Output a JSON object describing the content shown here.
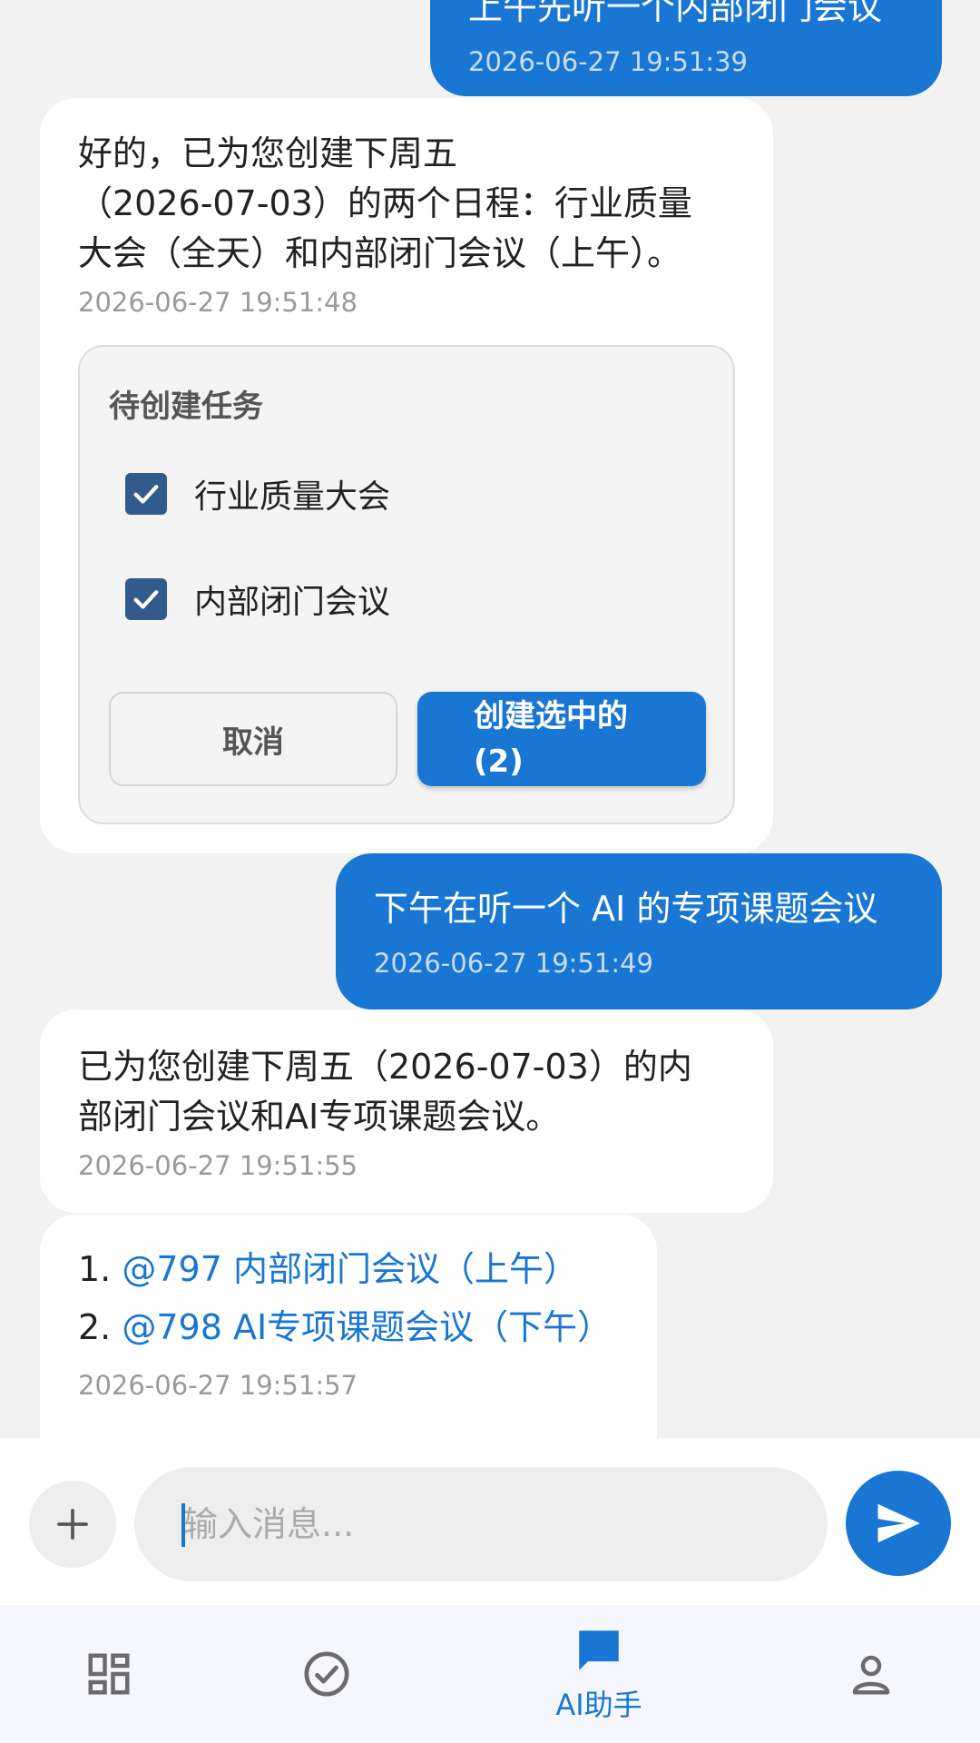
{
  "messages": [
    {
      "role": "user",
      "text": "上午先听一个内部闭门会议",
      "timestamp": "2026-06-27 19:51:39"
    },
    {
      "role": "assistant",
      "text_lines": [
        "好的，已为您创建下周五",
        "（2026-07-03）的两个日程：行业质量",
        "大会（全天）和内部闭门会议（上午）。"
      ],
      "timestamp": "2026-06-27 19:51:48"
    },
    {
      "role": "user",
      "text": "下午在听一个 AI 的专项课题会议",
      "timestamp": "2026-06-27 19:51:49"
    },
    {
      "role": "assistant",
      "text_lines": [
        "已为您创建下周五（2026-07-03）的内",
        "部闭门会议和AI专项课题会议。"
      ],
      "timestamp": "2026-06-27 19:51:55"
    },
    {
      "role": "assistant",
      "links": [
        {
          "prefix": "1. ",
          "text": "@797 内部闭门会议（上午）"
        },
        {
          "prefix": "2. ",
          "text": "@798 AI专项课题会议（下午）"
        }
      ],
      "timestamp": "2026-06-27 19:51:57"
    }
  ],
  "task_card": {
    "title": "待创建任务",
    "items": [
      {
        "label": "行业质量大会",
        "checked": true
      },
      {
        "label": "内部闭门会议",
        "checked": true
      }
    ],
    "cancel_label": "取消",
    "create_label_line1": "创建选中的",
    "create_label_line2": "(2)"
  },
  "input": {
    "placeholder": "输入消息...",
    "value": ""
  },
  "nav": {
    "items": [
      {
        "icon": "dashboard-icon",
        "label": ""
      },
      {
        "icon": "check-circle-icon",
        "label": ""
      },
      {
        "icon": "chat-icon",
        "label": "AI助手",
        "active": true
      },
      {
        "icon": "person-icon",
        "label": ""
      }
    ]
  },
  "colors": {
    "accent": "#1976d2",
    "checkbox": "#325a8c",
    "background": "#f2f2f2"
  }
}
